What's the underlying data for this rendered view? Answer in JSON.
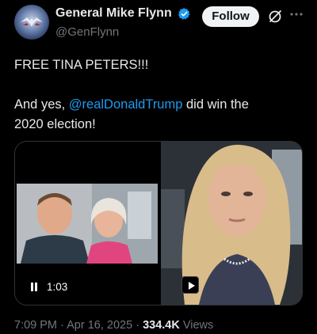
{
  "author": {
    "display_name": "General Mike Flynn",
    "handle": "@GenFlynn",
    "verified": true,
    "verified_color": "#1d9bf0"
  },
  "actions": {
    "follow_label": "Follow",
    "grok_icon": "grok-icon",
    "more_icon": "more-icon"
  },
  "tweet": {
    "line1": "FREE TINA PETERS!!!",
    "line2_prefix": "And yes, ",
    "mention": "@realDonaldTrump",
    "line2_suffix": " did win the",
    "line3": "2020 election!"
  },
  "media": {
    "video_duration": "1:03",
    "pause_icon": "pause-icon",
    "play_icon": "play-icon"
  },
  "meta": {
    "time": "7:09 PM",
    "separator": "·",
    "date": "Apr 16, 2025",
    "views_count": "334.4K",
    "views_label": "Views"
  },
  "colors": {
    "background": "#000000",
    "text": "#e7e9ea",
    "muted": "#71767b",
    "link": "#1d9bf0",
    "follow_bg": "#eff3f4"
  }
}
